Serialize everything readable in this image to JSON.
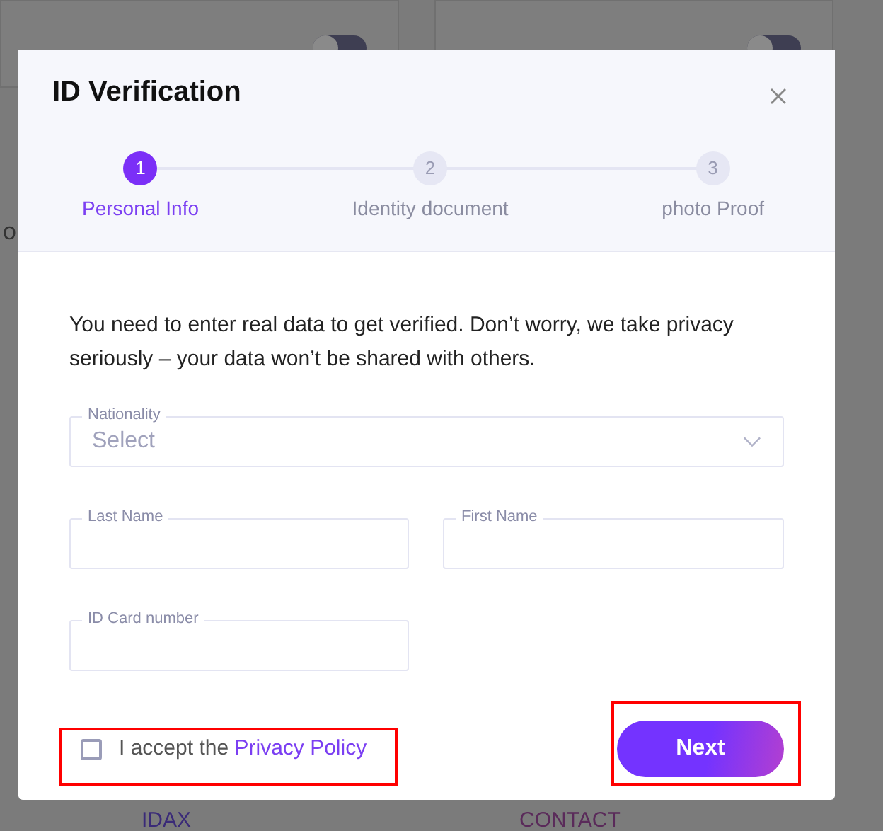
{
  "background": {
    "toggles": [
      {
        "on": false
      },
      {
        "on": false
      }
    ],
    "side_text": "o",
    "footer_links": [
      "IDAX",
      "CONTACT"
    ]
  },
  "dialog": {
    "title": "ID Verification",
    "steps": [
      {
        "number": "1",
        "label": "Personal Info",
        "selected": true
      },
      {
        "number": "2",
        "label": "Identity document",
        "selected": false
      },
      {
        "number": "3",
        "label": "photo Proof",
        "selected": false
      }
    ],
    "intro": "You need to enter real data to get verified. Don’t worry, we take privacy seriously – your data won’t be shared with others.",
    "nationality": {
      "label": "Nationality",
      "placeholder": "Select"
    },
    "fields": [
      {
        "label": "Last Name"
      },
      {
        "label": "First Name"
      },
      {
        "label": "ID Card number"
      }
    ],
    "accept": {
      "text": "I accept the",
      "link": "Privacy Policy",
      "checked": false,
      "highlighted": true
    },
    "next": {
      "label": "Next",
      "highlighted": true
    }
  }
}
